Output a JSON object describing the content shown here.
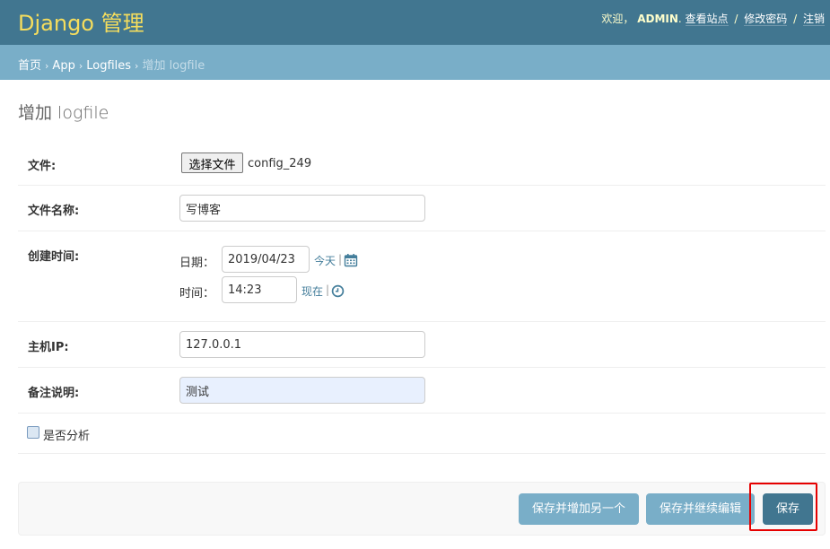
{
  "header": {
    "brand": "Django 管理",
    "welcome": "欢迎，",
    "username": "ADMIN",
    "view_site": "查看站点",
    "change_password": "修改密码",
    "logout": "注销",
    "separator": "/",
    "colors": {
      "bar": "#417690",
      "brand": "#f5dd5d"
    }
  },
  "breadcrumbs": {
    "home": "首页",
    "app": "App",
    "model": "Logfiles",
    "current": "增加 logfile",
    "arrow": "›"
  },
  "page": {
    "title": "增加 logfile"
  },
  "form": {
    "file": {
      "label": "文件:",
      "button": "选择文件",
      "filename": "config_249"
    },
    "file_name": {
      "label": "文件名称:",
      "value": "写博客"
    },
    "created": {
      "label": "创建时间:",
      "date_label": "日期：",
      "date_value": "2019/04/23",
      "today": "今天",
      "time_label": "时间：",
      "time_value": "14:23",
      "now": "现在",
      "pipe": "|",
      "date_icon": "calendar-icon",
      "time_icon": "clock-icon"
    },
    "host_ip": {
      "label": "主机IP:",
      "value": "127.0.0.1"
    },
    "remark": {
      "label": "备注说明:",
      "value": "测试"
    },
    "analyzed": {
      "label": "是否分析",
      "checked": false
    }
  },
  "submit": {
    "save_add_another": "保存并增加另一个",
    "save_continue": "保存并继续编辑",
    "save": "保存",
    "highlight_color": "#e60000"
  }
}
